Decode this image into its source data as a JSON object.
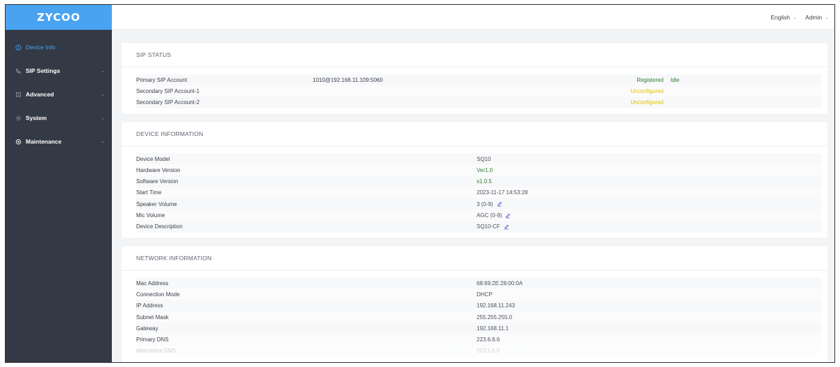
{
  "logo": "ZYCOO",
  "sidebar": {
    "items": [
      {
        "label": "Device Info",
        "icon": "info-circle-icon",
        "active": true
      },
      {
        "label": "SIP Settings",
        "icon": "phone-icon",
        "active": false
      },
      {
        "label": "Advanced",
        "icon": "document-icon",
        "active": false
      },
      {
        "label": "System",
        "icon": "gear-icon",
        "active": false
      },
      {
        "label": "Maintenance",
        "icon": "wrench-icon",
        "active": false
      }
    ]
  },
  "topbar": {
    "language": "English",
    "user": "Admin"
  },
  "sip_status": {
    "title": "SIP STATUS",
    "rows": [
      {
        "label": "Primary SIP Account",
        "address": "1010@192.168.11.109:5060",
        "status": "Registered",
        "state": "Idle"
      },
      {
        "label": "Secondary SIP Account-1",
        "address": "",
        "status": "Unconfigured",
        "state": ""
      },
      {
        "label": "Secondary SIP Account-2",
        "address": "",
        "status": "Unconfigured",
        "state": ""
      }
    ]
  },
  "device_info": {
    "title": "DEVICE INFORMATION",
    "rows": [
      {
        "label": "Device Model",
        "value": "SQ10"
      },
      {
        "label": "Hardware Version",
        "value": "Ver1.0"
      },
      {
        "label": "Software Version",
        "value": "s1.0.5"
      },
      {
        "label": "Start Time",
        "value": "2023-11-17 14:53:28"
      },
      {
        "label": "Speaker Volume",
        "value": "3 (0-9)"
      },
      {
        "label": "Mic Volume",
        "value": "AGC (0-9)"
      },
      {
        "label": "Device Description",
        "value": "SQ10-CF"
      }
    ]
  },
  "network_info": {
    "title": "NETWORK INFORMATION",
    "rows": [
      {
        "label": "Mac Address",
        "value": "68:69:2E:28:00:0A"
      },
      {
        "label": "Connection Mode",
        "value": "DHCP"
      },
      {
        "label": "IP Address",
        "value": "192.168.11.243"
      },
      {
        "label": "Subnet Mask",
        "value": "255.255.255.0"
      },
      {
        "label": "Gateway",
        "value": "192.168.11.1"
      },
      {
        "label": "Primary DNS",
        "value": "223.6.6.6"
      },
      {
        "label": "Alternative DNS",
        "value": "223.5.5.5"
      }
    ]
  },
  "colors": {
    "accent": "#4aa3f0",
    "sidebar": "#343a45",
    "registered": "#2e7d32",
    "unconfigured": "#e4c000"
  }
}
